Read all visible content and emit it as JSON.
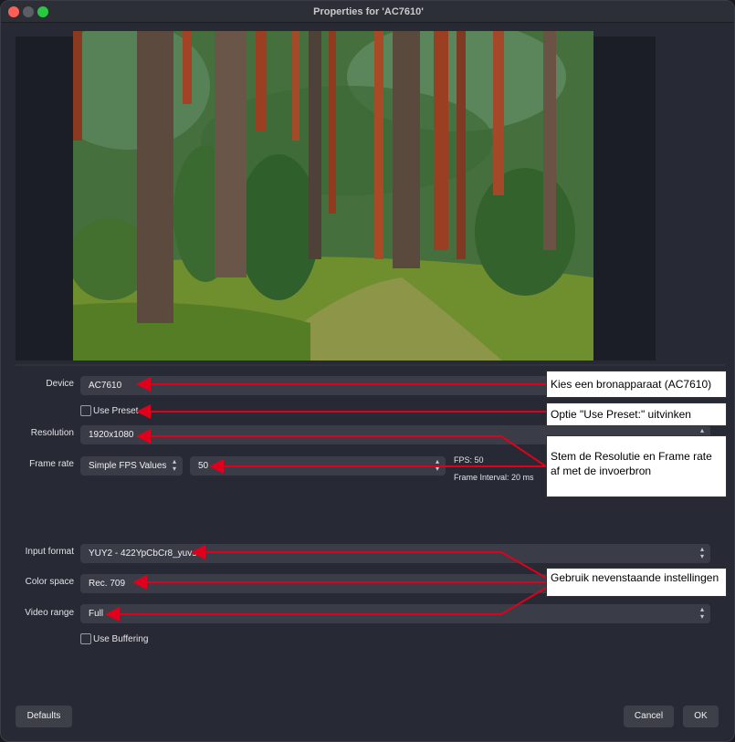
{
  "window": {
    "title": "Properties for 'AC7610'"
  },
  "preview": {
    "image": "forest-path-photo"
  },
  "form": {
    "device": {
      "label": "Device",
      "value": "AC7610"
    },
    "use_preset": {
      "label": "Use Preset",
      "checked": false
    },
    "resolution": {
      "label": "Resolution",
      "value": "1920x1080"
    },
    "frame_rate": {
      "label": "Frame rate",
      "mode": "Simple FPS Values",
      "value": "50",
      "fps_info": "FPS: 50",
      "interval_info": "Frame Interval: 20 ms"
    },
    "input_format": {
      "label": "Input format",
      "value": "YUY2 - 422YpCbCr8_yuvs"
    },
    "color_space": {
      "label": "Color space",
      "value": "Rec. 709"
    },
    "video_range": {
      "label": "Video range",
      "value": "Full"
    },
    "use_buffering": {
      "label": "Use Buffering",
      "checked": false
    }
  },
  "annotations": {
    "device_note": "Kies een bronapparaat (AC7610)",
    "preset_note": "Optie \"Use Preset:\" uitvinken",
    "resolution_note": "Stem de Resolutie en Frame rate af met de invoerbron",
    "format_note": "Gebruik nevenstaande instellingen",
    "arrow_color": "#e0001b"
  },
  "buttons": {
    "defaults": "Defaults",
    "cancel": "Cancel",
    "ok": "OK"
  },
  "icons": {
    "dropdown": "chevron-updown-icon",
    "checkbox": "checkbox-icon"
  }
}
